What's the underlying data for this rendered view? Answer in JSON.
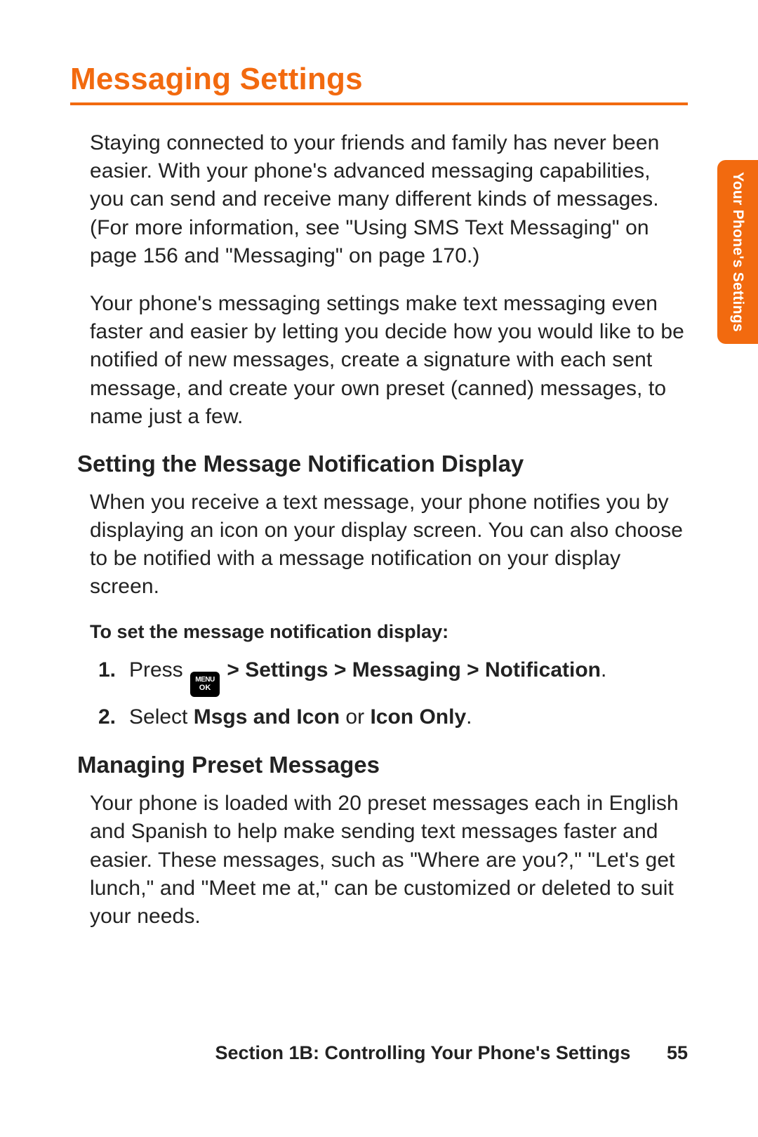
{
  "page": {
    "title": "Messaging Settings",
    "intro_p1": "Staying connected to your friends and family has never been easier. With your phone's advanced messaging capabilities, you can send and receive many different kinds of messages. (For more information, see \"Using SMS Text Messaging\" on page 156 and \"Messaging\" on page 170.)",
    "intro_p2": "Your phone's messaging settings make text messaging even faster and easier by letting you decide how you would like to be notified of new messages, create a signature with each sent message, and create your own preset (canned) messages, to name just a few.",
    "sections": {
      "notify": {
        "heading": "Setting the Message Notification Display",
        "body": "When you receive a text message, your phone notifies you by displaying an icon on your display screen. You can also choose to be notified with a message notification on your display screen.",
        "step_head": "To set the message notification display:",
        "steps": {
          "n1": "1.",
          "s1_press": "Press ",
          "s1_path": " > Settings > Messaging > Notification",
          "s1_dot": ".",
          "n2": "2.",
          "s2_select": "Select ",
          "s2_opt1": "Msgs and Icon",
          "s2_or": " or ",
          "s2_opt2": "Icon Only",
          "s2_dot": "."
        }
      },
      "preset": {
        "heading": "Managing Preset Messages",
        "body": "Your phone is loaded with 20 preset messages each in English and Spanish to help make sending text messages faster and easier. These messages, such as \"Where are you?,\" \"Let's get lunch,\" and \"Meet me at,\" can be customized or deleted to suit your needs."
      }
    }
  },
  "icons": {
    "menu_ok": {
      "line1": "MENU",
      "line2": "OK"
    }
  },
  "side_tab": {
    "label": "Your Phone's Settings"
  },
  "footer": {
    "section_label": "Section 1B: Controlling Your Phone's Settings",
    "page_number": "55"
  }
}
